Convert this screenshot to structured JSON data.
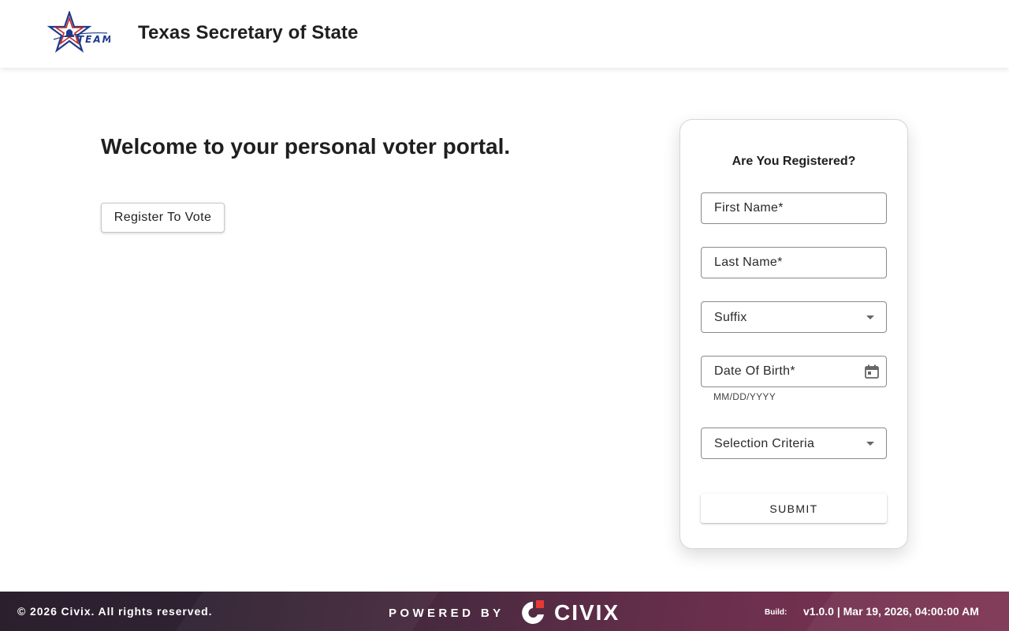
{
  "header": {
    "logo_text": "TEAM",
    "title": "Texas Secretary of State"
  },
  "main": {
    "welcome": "Welcome to your personal voter portal.",
    "register_button": "Register To Vote"
  },
  "form": {
    "title": "Are You Registered?",
    "first_name_placeholder": "First Name*",
    "last_name_placeholder": "Last Name*",
    "suffix_label": "Suffix",
    "dob_placeholder": "Date Of Birth*",
    "dob_hint": "MM/DD/YYYY",
    "selection_label": "Selection Criteria",
    "submit_label": "SUBMIT"
  },
  "footer": {
    "copyright": "© 2026 Civix. All rights reserved.",
    "powered_by": "POWERED BY",
    "brand": "CIVIX",
    "build_label": "Build:",
    "build_value": "v1.0.0 | Mar 19, 2026, 04:00:00 AM"
  },
  "colors": {
    "logo_blue": "#1e3a8a",
    "logo_red": "#c62828",
    "civix_red": "#e53935",
    "footer_dark": "#2b1f2e",
    "footer_accent": "#7d3352"
  },
  "icons": {
    "logo": "star-logo-icon",
    "calendar": "calendar-icon",
    "dropdown": "caret-down-icon",
    "civix": "civix-logo-icon"
  }
}
